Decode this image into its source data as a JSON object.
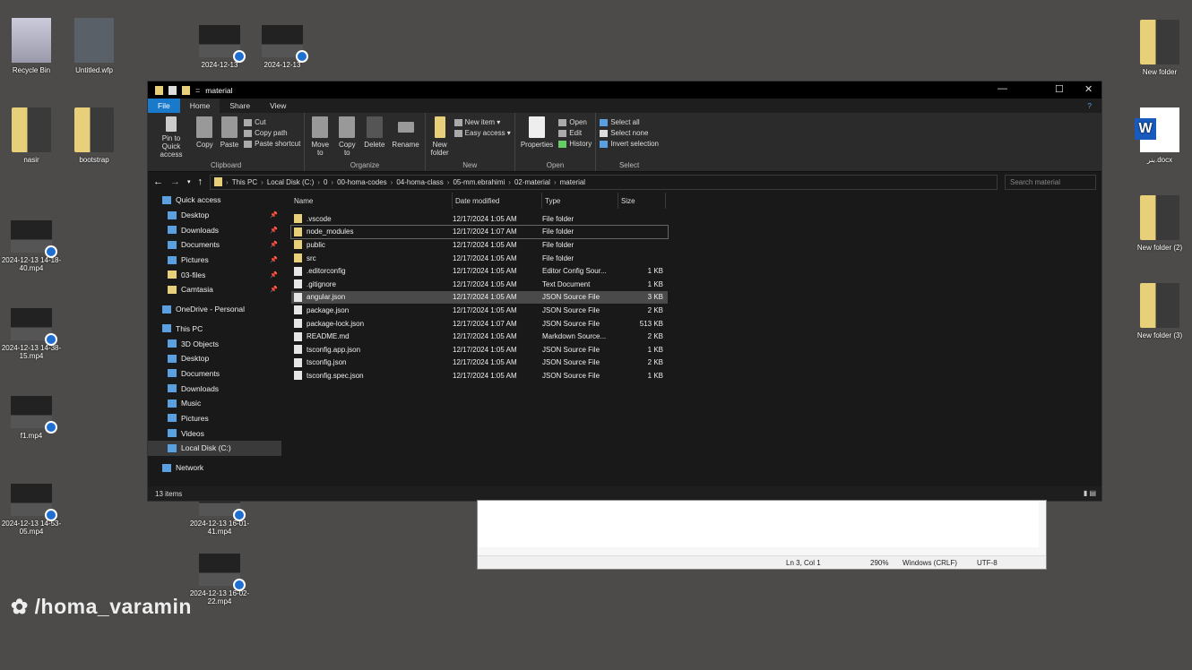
{
  "desktop": {
    "left": [
      {
        "label": "Recycle Bin",
        "icon": "recycle-bin"
      },
      {
        "label": "Untitled.wfp",
        "icon": "filmora-file"
      },
      {
        "label": "nasir",
        "icon": "folder"
      },
      {
        "label": "bootstrap",
        "icon": "folder"
      },
      {
        "label": "2024-12-13 14-18-40.mp4",
        "icon": "video"
      },
      {
        "label": "2024-12-13 14-38-15.mp4",
        "icon": "video"
      },
      {
        "label": "f1.mp4",
        "icon": "video"
      },
      {
        "label": "2024-12-13 14-53-05.mp4",
        "icon": "video"
      },
      {
        "label": "2024-12-13 16-01-41.mp4",
        "icon": "video"
      },
      {
        "label": "2024-12-13 16-02-22.mp4",
        "icon": "video"
      },
      {
        "label": "2024-12-13",
        "icon": "video"
      },
      {
        "label": "2024-12-13",
        "icon": "video"
      }
    ],
    "right": [
      {
        "label": "New folder",
        "icon": "folder"
      },
      {
        "label": "بنر.docx",
        "icon": "word-document"
      },
      {
        "label": "New folder (2)",
        "icon": "folder"
      },
      {
        "label": "New folder (3)",
        "icon": "folder"
      }
    ]
  },
  "explorer": {
    "title": "material",
    "tabs": [
      "File",
      "Home",
      "Share",
      "View"
    ],
    "ribbon": {
      "clipboard": {
        "label": "Clipboard",
        "pin": "Pin to Quick access",
        "copy": "Copy",
        "paste": "Paste",
        "cut": "Cut",
        "copy_path": "Copy path",
        "paste_shortcut": "Paste shortcut"
      },
      "organize": {
        "label": "Organize",
        "move": "Move to",
        "copy": "Copy to",
        "delete": "Delete",
        "rename": "Rename"
      },
      "new": {
        "label": "New",
        "folder": "New folder",
        "item": "New item",
        "easy": "Easy access"
      },
      "open": {
        "label": "Open",
        "properties": "Properties",
        "open": "Open",
        "edit": "Edit",
        "history": "History"
      },
      "select": {
        "label": "Select",
        "all": "Select all",
        "none": "Select none",
        "invert": "Invert selection"
      }
    },
    "path": [
      "This PC",
      "Local Disk (C:)",
      "0",
      "00-homa-codes",
      "04-homa-class",
      "05-mm.ebrahimi",
      "02-material",
      "material"
    ],
    "search_placeholder": "Search material",
    "nav": [
      {
        "label": "Quick access",
        "level": 0,
        "pin": false
      },
      {
        "label": "Desktop",
        "level": 1,
        "pin": true
      },
      {
        "label": "Downloads",
        "level": 1,
        "pin": true
      },
      {
        "label": "Documents",
        "level": 1,
        "pin": true
      },
      {
        "label": "Pictures",
        "level": 1,
        "pin": true
      },
      {
        "label": "03-files",
        "level": 1,
        "pin": true
      },
      {
        "label": "Camtasia",
        "level": 1,
        "pin": true
      },
      {
        "label": "",
        "level": -1
      },
      {
        "label": "OneDrive - Personal",
        "level": 0
      },
      {
        "label": "",
        "level": -1
      },
      {
        "label": "This PC",
        "level": 0
      },
      {
        "label": "3D Objects",
        "level": 1
      },
      {
        "label": "Desktop",
        "level": 1
      },
      {
        "label": "Documents",
        "level": 1
      },
      {
        "label": "Downloads",
        "level": 1
      },
      {
        "label": "Music",
        "level": 1
      },
      {
        "label": "Pictures",
        "level": 1
      },
      {
        "label": "Videos",
        "level": 1
      },
      {
        "label": "Local Disk (C:)",
        "level": 1,
        "selected": true
      },
      {
        "label": "",
        "level": -1
      },
      {
        "label": "Network",
        "level": 0
      }
    ],
    "columns": [
      "Name",
      "Date modified",
      "Type",
      "Size"
    ],
    "files": [
      {
        "name": ".vscode",
        "date": "12/17/2024 1:05 AM",
        "type": "File folder",
        "size": "",
        "folder": true
      },
      {
        "name": "node_modules",
        "date": "12/17/2024 1:07 AM",
        "type": "File folder",
        "size": "",
        "folder": true,
        "focus": true
      },
      {
        "name": "public",
        "date": "12/17/2024 1:05 AM",
        "type": "File folder",
        "size": "",
        "folder": true
      },
      {
        "name": "src",
        "date": "12/17/2024 1:05 AM",
        "type": "File folder",
        "size": "",
        "folder": true
      },
      {
        "name": ".editorconfig",
        "date": "12/17/2024 1:05 AM",
        "type": "Editor Config Sour...",
        "size": "1 KB"
      },
      {
        "name": ".gitignore",
        "date": "12/17/2024 1:05 AM",
        "type": "Text Document",
        "size": "1 KB"
      },
      {
        "name": "angular.json",
        "date": "12/17/2024 1:05 AM",
        "type": "JSON Source File",
        "size": "3 KB",
        "hover": true
      },
      {
        "name": "package.json",
        "date": "12/17/2024 1:05 AM",
        "type": "JSON Source File",
        "size": "2 KB"
      },
      {
        "name": "package-lock.json",
        "date": "12/17/2024 1:07 AM",
        "type": "JSON Source File",
        "size": "513 KB"
      },
      {
        "name": "README.md",
        "date": "12/17/2024 1:05 AM",
        "type": "Markdown Source...",
        "size": "2 KB"
      },
      {
        "name": "tsconfig.app.json",
        "date": "12/17/2024 1:05 AM",
        "type": "JSON Source File",
        "size": "1 KB"
      },
      {
        "name": "tsconfig.json",
        "date": "12/17/2024 1:05 AM",
        "type": "JSON Source File",
        "size": "2 KB"
      },
      {
        "name": "tsconfig.spec.json",
        "date": "12/17/2024 1:05 AM",
        "type": "JSON Source File",
        "size": "1 KB"
      }
    ],
    "status": "13 items"
  },
  "notepad": {
    "position": "Ln 3, Col 1",
    "zoom": "290%",
    "line_ending": "Windows (CRLF)",
    "encoding": "UTF-8"
  },
  "watermark": "/homa_varamin",
  "colors": {
    "accent": "#1979ca",
    "folder": "#e8cf7a"
  }
}
